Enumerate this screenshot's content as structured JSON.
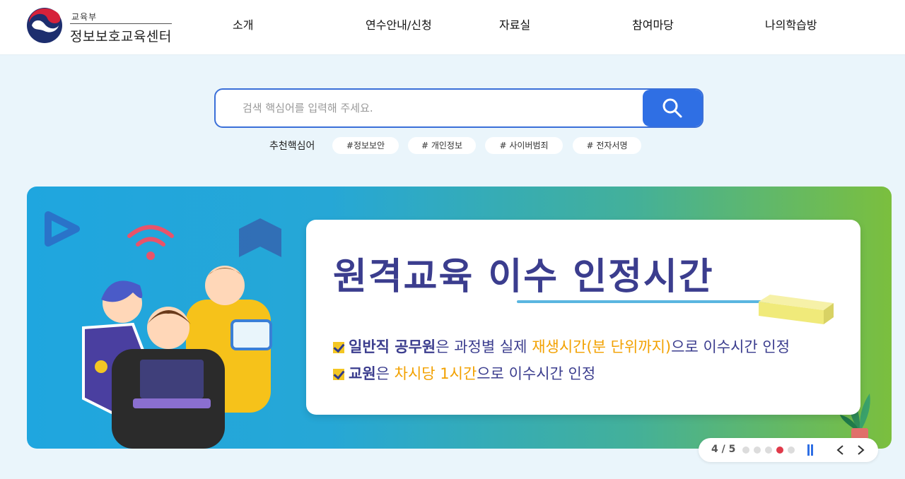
{
  "header": {
    "ministry": "교육부",
    "center_name": "정보보호교육센터",
    "nav": [
      "소개",
      "연수안내/신청",
      "자료실",
      "참여마당",
      "나의학습방"
    ]
  },
  "search": {
    "placeholder": "검색 핵심어를 입력해 주세요.",
    "recommend_label": "추천핵심어",
    "keywords": [
      "#정보보안",
      "# 개인정보",
      "# 사이버범죄",
      "# 전자서명"
    ]
  },
  "banner": {
    "title": "원격교육 이수 인정시간",
    "line1": {
      "emphasis": "일반직 공무원",
      "text_a": "은 과정별 실제 ",
      "highlight": "재생시간(분 단위까지)",
      "text_b": "으로 이수시간 인정"
    },
    "line2": {
      "emphasis": "교원",
      "text_a": "은 ",
      "highlight": "차시당 1시간",
      "text_b": "으로 이수시간 인정"
    }
  },
  "slider": {
    "counter": "4 / 5",
    "total": 5,
    "current": 4
  },
  "colors": {
    "primary": "#2f6fe4",
    "title": "#3b3d8e",
    "highlight": "#f2a100",
    "active_dot": "#e03a4a"
  }
}
